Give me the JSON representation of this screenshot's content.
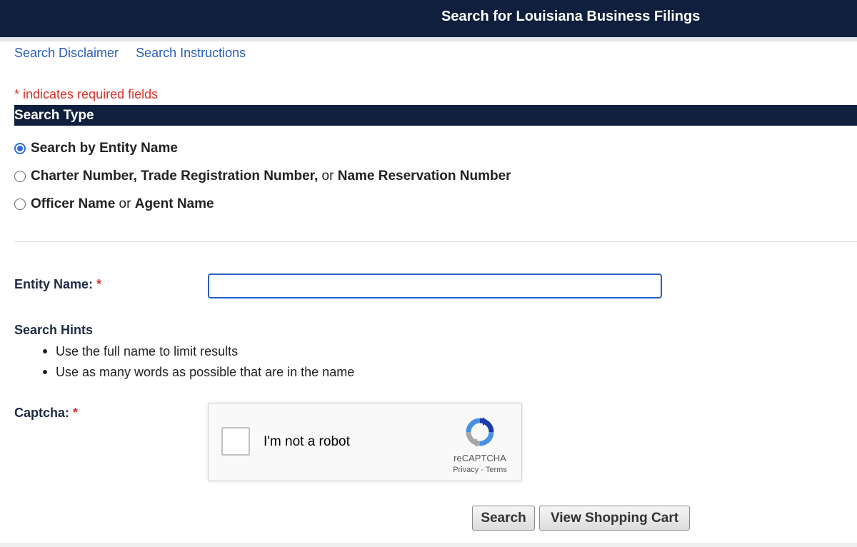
{
  "header": {
    "title": "Search for Louisiana Business Filings"
  },
  "links": {
    "disclaimer": "Search Disclaimer",
    "instructions": "Search Instructions"
  },
  "required_note": "* indicates required fields",
  "search_type": {
    "title": "Search Type",
    "options": [
      {
        "parts": [
          "Search by Entity Name"
        ],
        "selected": true
      },
      {
        "parts": [
          "Charter Number, Trade Registration Number,",
          " or ",
          "Name Reservation Number"
        ],
        "selected": false
      },
      {
        "parts": [
          "Officer Name",
          " or ",
          "Agent Name"
        ],
        "selected": false
      }
    ]
  },
  "entity_name": {
    "label": "Entity Name:",
    "required_marker": "*",
    "value": "",
    "placeholder": ""
  },
  "hints": {
    "title": "Search Hints",
    "items": [
      "Use the full name to limit results",
      "Use as many words as possible that are in the name"
    ]
  },
  "captcha": {
    "label": "Captcha:",
    "required_marker": "*",
    "checkbox_label": "I'm not a robot",
    "brand": "reCAPTCHA",
    "privacy": "Privacy",
    "separator": " - ",
    "terms": "Terms",
    "checked": false
  },
  "buttons": {
    "search": "Search",
    "cart": "View Shopping Cart"
  },
  "colors": {
    "navy": "#0f1f3d",
    "link": "#2a5cba",
    "required": "#d9312b",
    "focus": "#2c5ec8"
  }
}
